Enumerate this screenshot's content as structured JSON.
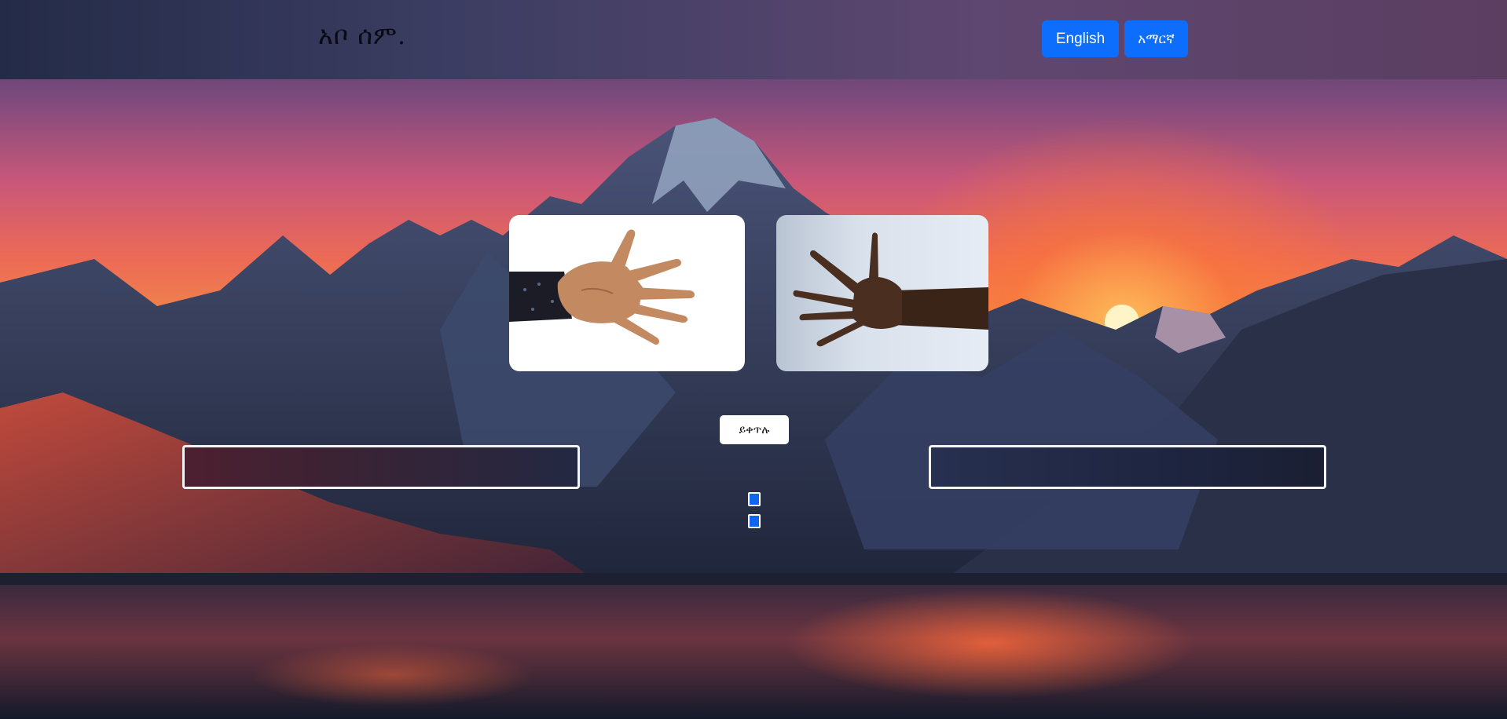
{
  "header": {
    "brand": "አቦ ሰም.",
    "languages": [
      {
        "label": "English"
      },
      {
        "label": "አማርኛ"
      }
    ]
  },
  "game": {
    "continue_label": "ይቀጥሉ",
    "player_hand": "open-palm-hand",
    "opponent_hand": "open-hand-reaching"
  },
  "colors": {
    "accent": "#0d6efd",
    "panel_border": "#f4f4f6"
  },
  "icons": {
    "player_card": "palm-hand-icon",
    "opponent_card": "reaching-hand-icon"
  }
}
